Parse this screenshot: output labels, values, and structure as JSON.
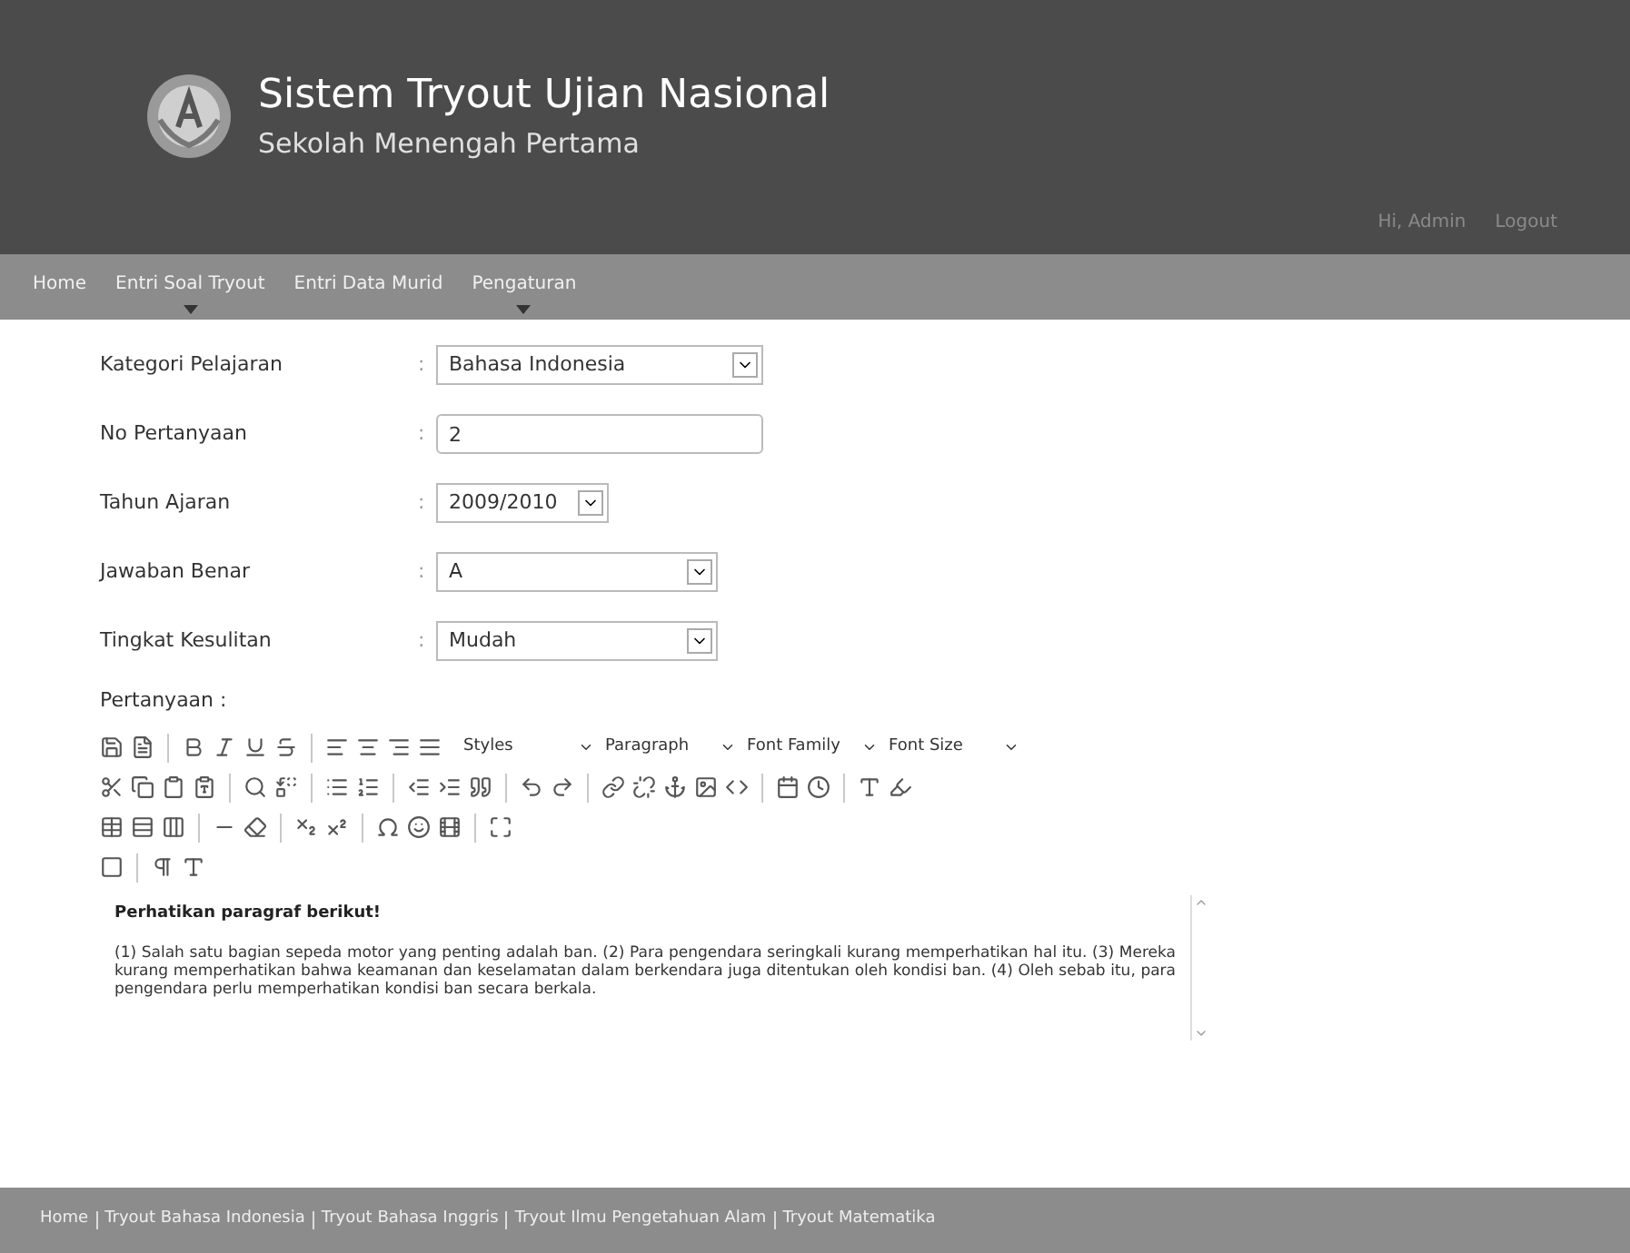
{
  "header": {
    "title": "Sistem Tryout Ujian Nasional",
    "subtitle": "Sekolah Menengah Pertama",
    "links": [
      "Hi, Admin",
      "Logout"
    ]
  },
  "nav": [
    {
      "label": "Home",
      "has_dropdown": false
    },
    {
      "label": "Entri Soal Tryout",
      "has_dropdown": true
    },
    {
      "label": "Entri Data Murid",
      "has_dropdown": false
    },
    {
      "label": "Pengaturan",
      "has_dropdown": true
    }
  ],
  "form": [
    {
      "label": "Kategori Pelajaran",
      "separator": ":",
      "kind": "select",
      "value": "Bahasa Indonesia"
    },
    {
      "label": "No Pertanyaan",
      "separator": ":",
      "kind": "text",
      "value": "2"
    },
    {
      "label": "Tahun Ajaran",
      "separator": ":",
      "kind": "select",
      "value": "2009/2010"
    },
    {
      "label": "Jawaban Benar",
      "separator": ":",
      "kind": "select",
      "value": "A"
    },
    {
      "label": "Tingkat Kesulitan",
      "separator": ":",
      "kind": "select",
      "value": "Mudah"
    }
  ],
  "editor": {
    "label": "Pertanyaan :",
    "dropdowns": [
      "Styles",
      "Paragraph",
      "Font Family",
      "Font Size"
    ],
    "heading": "Perhatikan paragraf berikut!",
    "paragraph": "(1) Salah satu bagian sepeda motor yang penting adalah ban. (2) Para pengendara seringkali kurang memperhatikan hal itu. (3) Mereka kurang memperhatikan bahwa keamanan dan keselamatan dalam berkendara juga ditentukan oleh kondisi ban. (4) Oleh sebab itu, para pengendara perlu memperhatikan kondisi ban secara berkala."
  },
  "footer": [
    "Home",
    "Tryout Bahasa Indonesia",
    "Tryout Bahasa Inggris",
    "Tryout Ilmu Pengetahuan Alam",
    "Tryout Matematika"
  ]
}
